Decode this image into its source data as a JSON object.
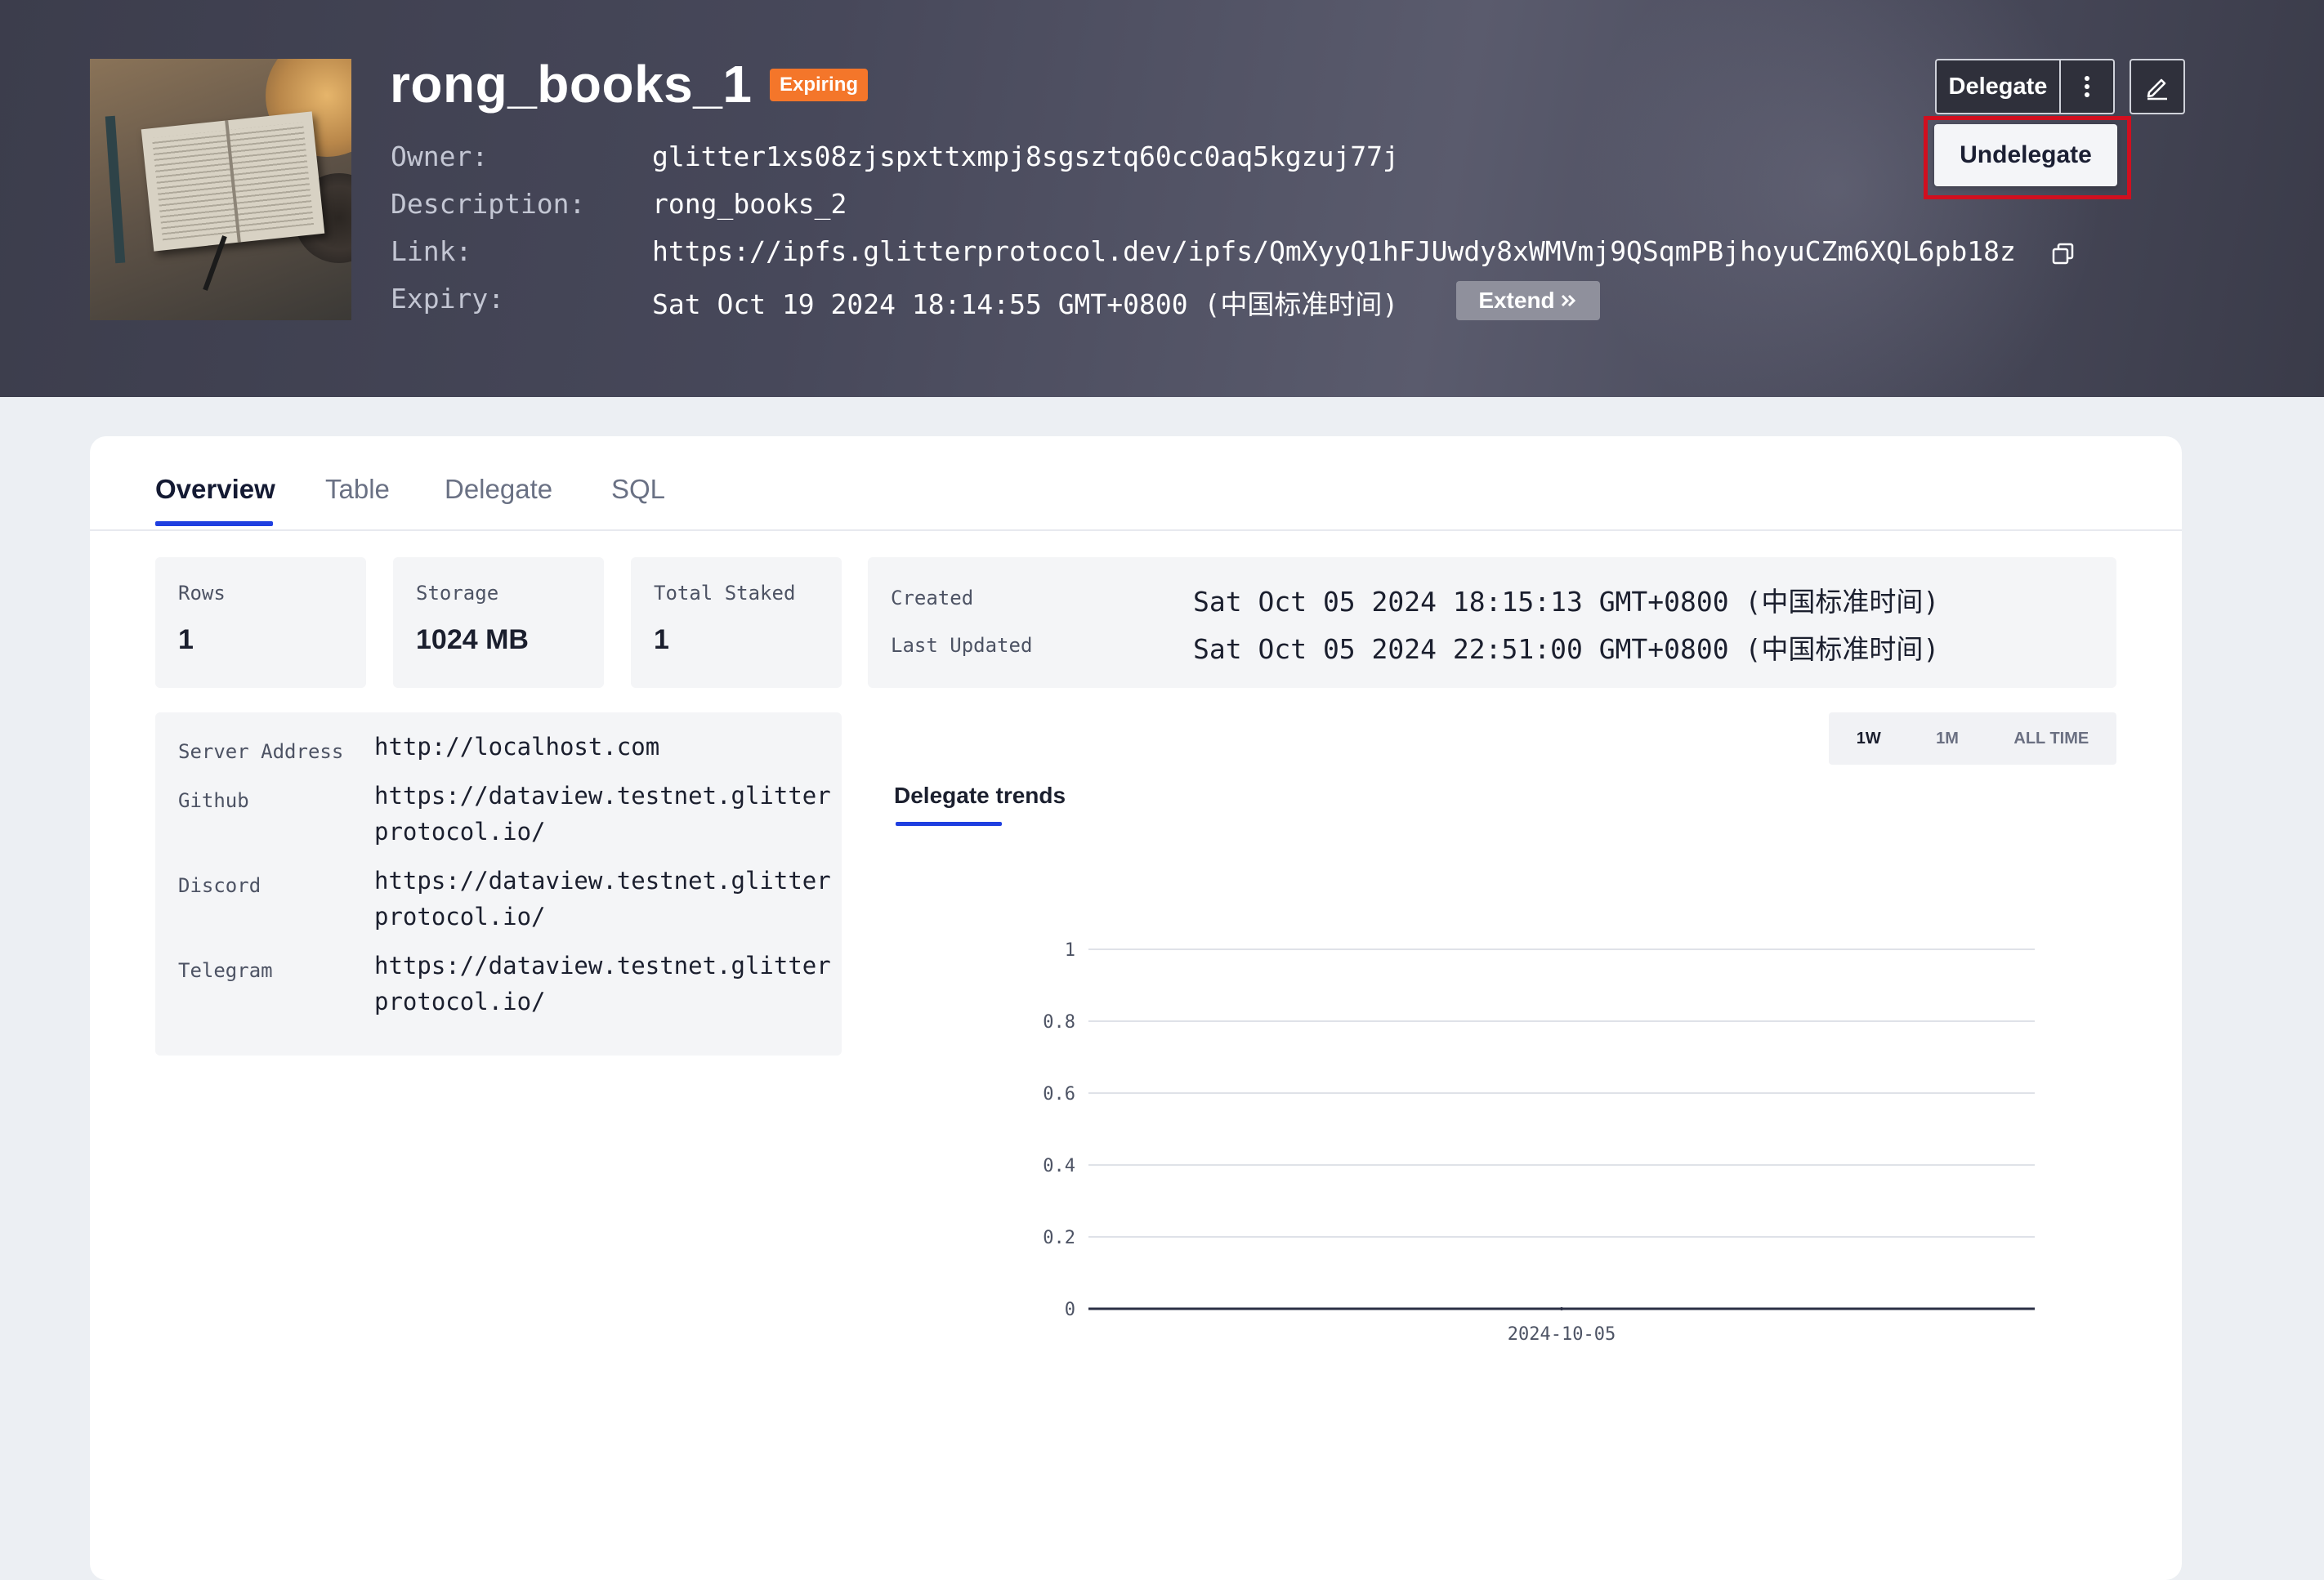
{
  "header": {
    "title": "rong_books_1",
    "status_badge": "Expiring",
    "labels": {
      "owner": "Owner:",
      "description": "Description:",
      "link": "Link:",
      "expiry": "Expiry:"
    },
    "owner": "glitter1xs08zjspxttxmpj8sgsztq60cc0aq5kgzuj77j",
    "description": "rong_books_2",
    "link": "https://ipfs.glitterprotocol.dev/ipfs/QmXyyQ1hFJUwdy8xWMVmj9QSqmPBjhoyuCZm6XQL6pb18z",
    "expiry": "Sat Oct 19 2024 18:14:55 GMT+0800 (中国标准时间)",
    "extend_label": "Extend",
    "delegate_label": "Delegate",
    "undelegate_label": "Undelegate",
    "icons": [
      "copy-icon",
      "kebab-menu-icon",
      "edit-icon",
      "double-chevron-right-icon"
    ]
  },
  "tabs": [
    "Overview",
    "Table",
    "Delegate",
    "SQL"
  ],
  "active_tab": "Overview",
  "stats": {
    "rows": {
      "label": "Rows",
      "value": "1"
    },
    "storage": {
      "label": "Storage",
      "value": "1024 MB"
    },
    "total_staked": {
      "label": "Total Staked",
      "value": "1"
    }
  },
  "dates": {
    "created_label": "Created",
    "created": "Sat Oct 05 2024 18:15:13 GMT+0800 (中国标准时间)",
    "updated_label": "Last Updated",
    "updated": "Sat Oct 05 2024 22:51:00 GMT+0800 (中国标准时间)"
  },
  "links": {
    "server_label": "Server Address",
    "server": "http://localhost.com",
    "github_label": "Github",
    "github": "https://dataview.testnet.glitterprotocol.io/",
    "discord_label": "Discord",
    "discord": "https://dataview.testnet.glitterprotocol.io/",
    "telegram_label": "Telegram",
    "telegram": "https://dataview.testnet.glitterprotocol.io/"
  },
  "range": {
    "options": [
      "1W",
      "1M",
      "ALL TIME"
    ],
    "active": "1W"
  },
  "chart_tab": "Delegate trends",
  "colors": {
    "accent": "#1f3fe0",
    "badge": "#f4762a",
    "highlight": "#d10f1f"
  },
  "chart_data": {
    "type": "line",
    "title": "",
    "x": [
      "2024-10-05"
    ],
    "series": [
      {
        "values": [
          0
        ]
      }
    ],
    "ylim": [
      0,
      1
    ],
    "yticks": [
      "0",
      "0.2",
      "0.4",
      "0.6",
      "0.8",
      "1"
    ],
    "grid": true
  }
}
